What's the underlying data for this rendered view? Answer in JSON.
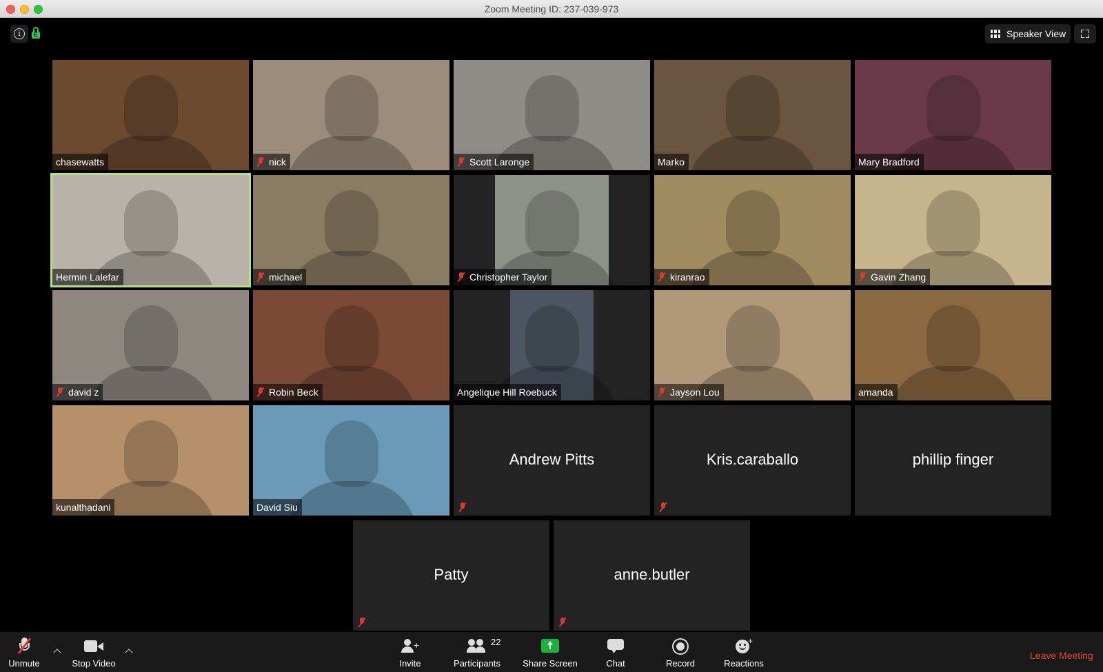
{
  "window": {
    "title": "Zoom Meeting ID: 237-039-973"
  },
  "top_bar": {
    "info_icon": "info-icon",
    "lock_label": "E",
    "speaker_view_label": "Speaker View"
  },
  "colors": {
    "active_speaker_outline": "#b7e07a",
    "muted_red": "#e0382f",
    "leave_red": "#e5452f",
    "share_green": "#19b23a"
  },
  "participants": [
    {
      "name": "chasewatts",
      "muted": false,
      "video": true,
      "bg": "#6b4a30"
    },
    {
      "name": "nick",
      "muted": true,
      "video": true,
      "bg": "#9c8c7c"
    },
    {
      "name": "Scott Laronge",
      "muted": true,
      "video": true,
      "bg": "#8f8b86"
    },
    {
      "name": "Marko",
      "muted": false,
      "video": true,
      "bg": "#6b5540"
    },
    {
      "name": "Mary Bradford",
      "muted": false,
      "video": true,
      "bg": "#6a3a4a"
    },
    {
      "name": "Hermin Lalefar",
      "muted": false,
      "video": true,
      "bg": "#b8b2a8",
      "active": true
    },
    {
      "name": "michael",
      "muted": true,
      "video": true,
      "bg": "#8a7c62"
    },
    {
      "name": "Christopher Taylor",
      "muted": true,
      "video": true,
      "bg": "#8d9288"
    },
    {
      "name": "kiranrao",
      "muted": true,
      "video": true,
      "bg": "#a08a60"
    },
    {
      "name": "Gavin Zhang",
      "muted": true,
      "video": true,
      "bg": "#c6b48c"
    },
    {
      "name": "david z",
      "muted": true,
      "video": true,
      "bg": "#8e8780"
    },
    {
      "name": "Robin Beck",
      "muted": true,
      "video": true,
      "bg": "#7a4a36"
    },
    {
      "name": "Angelique Hill Roebuck",
      "muted": false,
      "video": true,
      "bg": "#4c5662"
    },
    {
      "name": "Jayson Lou",
      "muted": true,
      "video": true,
      "bg": "#b09878"
    },
    {
      "name": "amanda",
      "muted": false,
      "video": true,
      "bg": "#8a6840"
    },
    {
      "name": "kunalthadani",
      "muted": false,
      "video": true,
      "bg": "#b5906a"
    },
    {
      "name": "David Siu",
      "muted": false,
      "video": true,
      "bg": "#6a9ab8"
    },
    {
      "name": "Andrew Pitts",
      "muted": true,
      "video": false
    },
    {
      "name": "Kris.caraballo",
      "muted": true,
      "video": false
    },
    {
      "name": "phillip finger",
      "muted": false,
      "video": false
    },
    {
      "name": "Patty",
      "muted": true,
      "video": false
    },
    {
      "name": "anne.butler",
      "muted": true,
      "video": false
    }
  ],
  "toolbar": {
    "unmute": "Unmute",
    "stop_video": "Stop Video",
    "invite": "Invite",
    "participants": "Participants",
    "participant_count": "22",
    "share_screen": "Share Screen",
    "chat": "Chat",
    "record": "Record",
    "reactions": "Reactions",
    "leave": "Leave Meeting"
  }
}
